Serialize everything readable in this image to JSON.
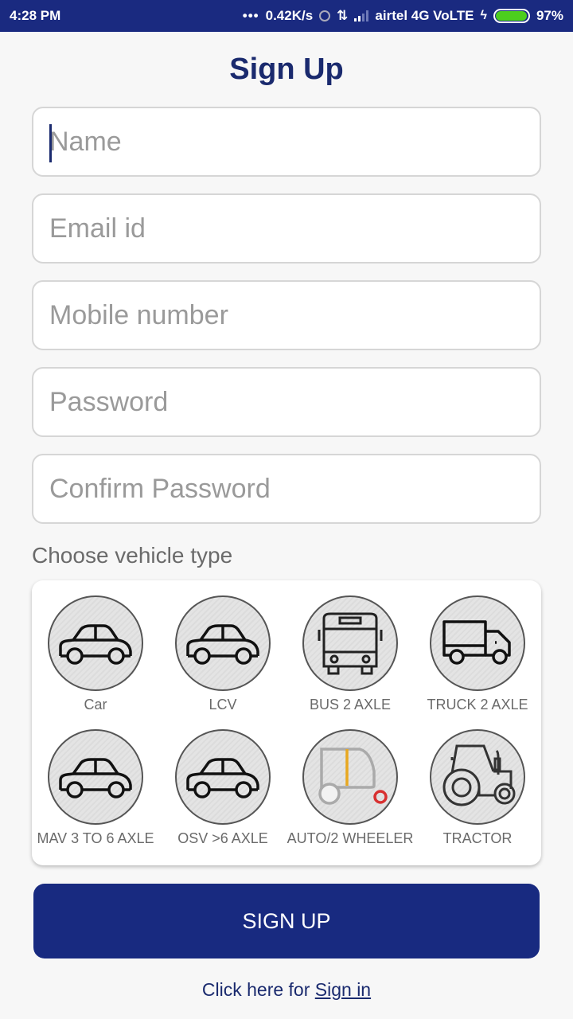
{
  "status_bar": {
    "time": "4:28 PM",
    "dots": "•••",
    "speed": "0.42K/s",
    "data_arrows": "⇅",
    "carrier": "airtel 4G VoLTE",
    "charging": "ϟ",
    "battery_percent": "97%",
    "battery_level": 0.97,
    "battery_color": "#4cce1e"
  },
  "page": {
    "title": "Sign Up"
  },
  "form": {
    "name": {
      "value": "",
      "placeholder": "Name"
    },
    "email": {
      "value": "",
      "placeholder": "Email id"
    },
    "mobile": {
      "value": "",
      "placeholder": "Mobile number"
    },
    "password": {
      "value": "",
      "placeholder": "Password"
    },
    "confirm_password": {
      "value": "",
      "placeholder": "Confirm Password"
    }
  },
  "vehicle_section": {
    "label": "Choose vehicle type",
    "options": [
      {
        "label": "Car",
        "icon": "car-icon"
      },
      {
        "label": "LCV",
        "icon": "car-icon"
      },
      {
        "label": "BUS 2 AXLE",
        "icon": "bus-icon"
      },
      {
        "label": "TRUCK 2 AXLE",
        "icon": "truck-icon"
      },
      {
        "label": "MAV 3 TO 6 AXLE",
        "icon": "car-icon"
      },
      {
        "label": "OSV >6 AXLE",
        "icon": "car-icon"
      },
      {
        "label": "AUTO/2 WHEELER",
        "icon": "auto-rickshaw-icon"
      },
      {
        "label": "TRACTOR",
        "icon": "tractor-icon"
      }
    ]
  },
  "actions": {
    "signup_label": "SIGN UP",
    "signin_prefix": "Click here for ",
    "signin_link": "Sign in"
  },
  "colors": {
    "primary": "#182a80",
    "title_text": "#1a2a6e"
  }
}
